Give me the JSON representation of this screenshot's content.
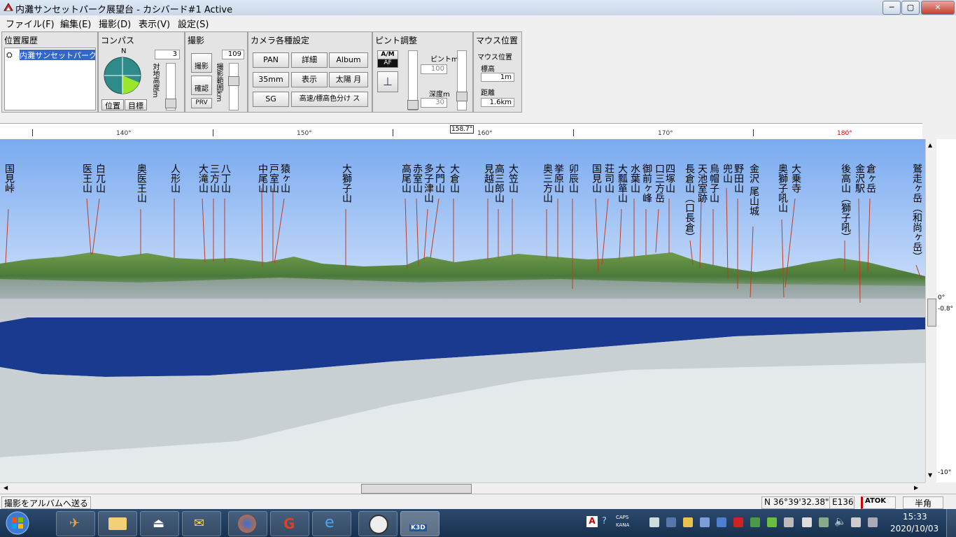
{
  "window": {
    "title": "内灘サンセットパーク展望台 - カシバード#1 Active"
  },
  "menu": [
    "ファイル(F)",
    "編集(E)",
    "撮影(D)",
    "表示(V)",
    "設定(S)"
  ],
  "panels": {
    "history": {
      "title": "位置履歴",
      "item": "内灘サンセットパーク展"
    },
    "compass": {
      "title": "コンパス",
      "north": "N",
      "value": "3",
      "vlabel": "対地高度m",
      "btn_pos": "位置",
      "btn_target": "目標"
    },
    "shoot": {
      "title": "撮影",
      "btn_shoot": "撮影",
      "btn_confirm": "確認",
      "btn_prv": "PRV",
      "value": "109",
      "vlabel": "撮影範囲km"
    },
    "camera": {
      "title": "カメラ各種設定",
      "btn_pan": "PAN",
      "btn_detail": "詳細",
      "btn_album": "Album",
      "btn_35": "35mm",
      "btn_display": "表示",
      "btn_sun": "太陽 月",
      "btn_sg": "SG",
      "btn_color": "高速/標高色分け ス"
    },
    "focus": {
      "title": "ピント調整",
      "btn_am": "A/M",
      "btn_af": "AF",
      "pinto_label": "ピントm",
      "pinto_value": "100",
      "depth_label": "深度m",
      "depth_value": "30"
    },
    "mouse": {
      "title": "マウス位置",
      "pos_label": "マウス位置",
      "alt_label": "標高",
      "alt_value": "1m",
      "dist_label": "距離",
      "dist_value": "1.6km"
    }
  },
  "ruler": {
    "labels": [
      "140°",
      "150°",
      "160°",
      "170°",
      "180°"
    ],
    "current": "158.7°"
  },
  "right_axis": [
    "0°",
    "-0.8°",
    "-10°"
  ],
  "peaks": [
    "国見峠",
    "医王山",
    "白兀山",
    "奥医王山",
    "人形山",
    "大滝山",
    "三方山",
    "八丁山",
    "中尾山",
    "戸室山",
    "猿ヶ山",
    "大獅子山",
    "高尾山",
    "赤室山",
    "多子津山",
    "大門山",
    "大倉山",
    "見越山",
    "高三郎山",
    "大笠山",
    "奥三方山",
    "挙原山",
    "卯辰山",
    "国見山",
    "荘司山",
    "大瓢箪山",
    "水葉山",
    "御前ヶ峰",
    "口三方岳",
    "四塚山",
    "長倉山（口長倉）",
    "天池室跡",
    "烏帽子山",
    "兜山",
    "野田山",
    "金沢 尾山城",
    "奥獅子吼山",
    "大乗寺",
    "後高山（獅子吼）",
    "金沢駅",
    "倉ヶ岳",
    "鷲走ヶ岳（和尚ヶ岳）"
  ],
  "status": {
    "left": "撮影をアルバムへ送る",
    "coord": "N 36°39'32.38\"",
    "east": "E136",
    "ime": "ATOK",
    "mode": "半角"
  },
  "taskbar": {
    "time": "15:33",
    "date": "2020/10/03",
    "caps": "CAPS",
    "kana": "KANA"
  }
}
